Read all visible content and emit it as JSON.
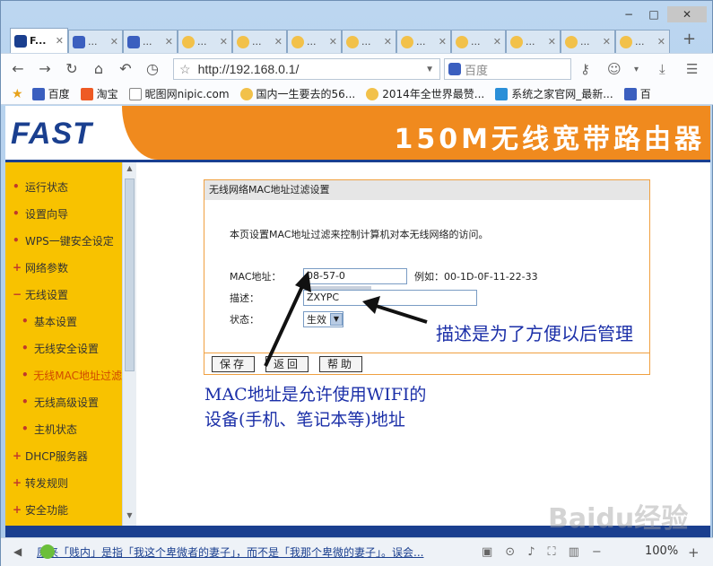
{
  "window": {
    "minimize": "−",
    "maximize": "□",
    "close": "✕"
  },
  "tabs": [
    {
      "label": "F...",
      "icon": "fast-icon",
      "active": true
    },
    {
      "label": "...",
      "icon": "paw-icon"
    },
    {
      "label": "...",
      "icon": "paw-icon"
    },
    {
      "label": "...",
      "icon": "smile-icon"
    },
    {
      "label": "...",
      "icon": "smile-icon"
    },
    {
      "label": "...",
      "icon": "smile-icon"
    },
    {
      "label": "...",
      "icon": "smile-icon"
    },
    {
      "label": "...",
      "icon": "smile-icon"
    },
    {
      "label": "...",
      "icon": "smile-icon"
    },
    {
      "label": "...",
      "icon": "smile-icon"
    },
    {
      "label": "...",
      "icon": "smile-icon"
    },
    {
      "label": "...",
      "icon": "smile-icon"
    }
  ],
  "new_tab": "+",
  "address": {
    "url": "http://192.168.0.1/"
  },
  "search": {
    "placeholder": "百度"
  },
  "bookmarks": [
    {
      "label": "百度",
      "icon": "paw-icon"
    },
    {
      "label": "淘宝",
      "icon": "taobao-icon"
    },
    {
      "label": "昵图网nipic.com",
      "icon": "page-icon"
    },
    {
      "label": "国内一生要去的56...",
      "icon": "smile-icon"
    },
    {
      "label": "2014年全世界最赞...",
      "icon": "smile-icon"
    },
    {
      "label": "系统之家官网_最新...",
      "icon": "ie-icon"
    },
    {
      "label": "百",
      "icon": "paw-icon"
    }
  ],
  "router": {
    "logo": "FAST",
    "product": "150M无线宽带路由器",
    "menu": [
      {
        "label": "运行状态",
        "marker": "•",
        "sub": false
      },
      {
        "label": "设置向导",
        "marker": "•",
        "sub": false
      },
      {
        "label": "WPS一键安全设定",
        "marker": "•",
        "sub": false
      },
      {
        "label": "网络参数",
        "marker": "+",
        "sub": false
      },
      {
        "label": "无线设置",
        "marker": "−",
        "sub": false
      },
      {
        "label": "基本设置",
        "marker": "•",
        "sub": true
      },
      {
        "label": "无线安全设置",
        "marker": "•",
        "sub": true
      },
      {
        "label": "无线MAC地址过滤",
        "marker": "•",
        "sub": true,
        "selected": true
      },
      {
        "label": "无线高级设置",
        "marker": "•",
        "sub": true
      },
      {
        "label": "主机状态",
        "marker": "•",
        "sub": true
      },
      {
        "label": "DHCP服务器",
        "marker": "+",
        "sub": false
      },
      {
        "label": "转发规则",
        "marker": "+",
        "sub": false
      },
      {
        "label": "安全功能",
        "marker": "+",
        "sub": false
      }
    ],
    "panel": {
      "title": "无线网络MAC地址过滤设置",
      "description": "本页设置MAC地址过滤来控制计算机对本无线网络的访问。",
      "mac_label": "MAC地址：",
      "mac_value": "08-57-0",
      "mac_example": "例如：00-1D-0F-11-22-33",
      "desc_label": "描述：",
      "desc_value": "ZXYPC",
      "status_label": "状态：",
      "status_value": "生效",
      "buttons": {
        "save": "保存",
        "back": "返回",
        "help": "帮助"
      }
    }
  },
  "annotations": {
    "note1": "描述是为了方便以后管理",
    "note2_line1": "MAC地址是允许使用WIFI的",
    "note2_line2": "设备(手机、笔记本等)地址"
  },
  "status_bar": {
    "news": "原来「贱内」是指「我这个卑微者的妻子」，而不是「我那个卑微的妻子」。误会...",
    "zoom": "100%"
  },
  "watermark": "Baidu经验"
}
